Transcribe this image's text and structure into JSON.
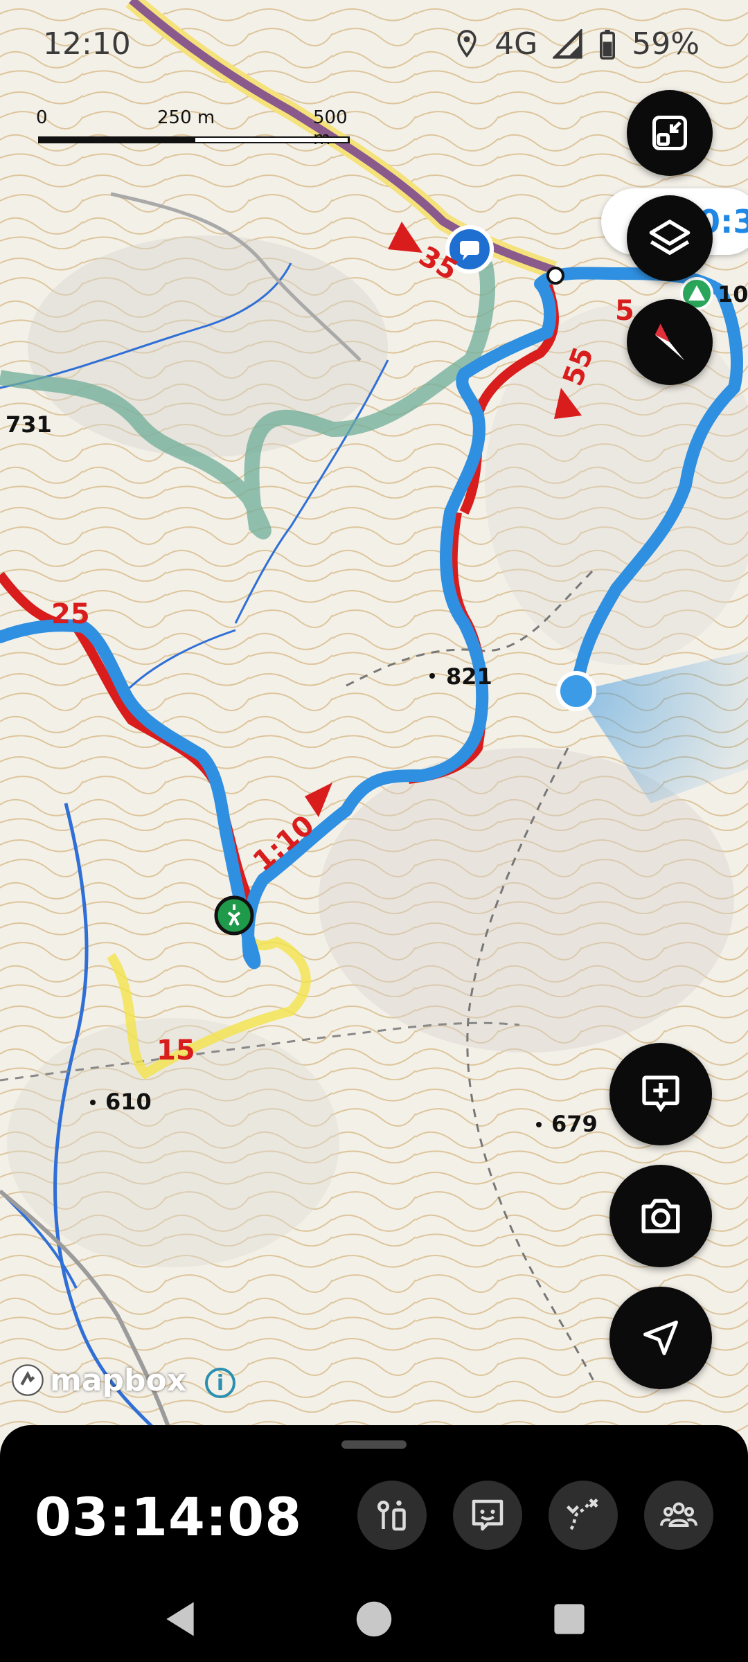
{
  "status_bar": {
    "time": "12:10",
    "network": "4G",
    "battery": "59%"
  },
  "scale_bar": {
    "start": "0",
    "mid": "250 m",
    "end": "500 m"
  },
  "map": {
    "route_number_labels": [
      "35",
      "55",
      "5",
      "25",
      "1:10",
      "15"
    ],
    "elevation_labels": [
      "731",
      "821",
      "610",
      "679",
      "10"
    ],
    "attribution": "mapbox"
  },
  "time_pill": {
    "text": "0:3"
  },
  "bottom_panel": {
    "elapsed_time": "03:14:08"
  },
  "colors": {
    "route_blue": "#2f8fe0",
    "route_red": "#d91c1c",
    "trail_yellow": "#f3e34a",
    "contour": "#c9a25a",
    "river": "#2f6fd6",
    "fab_bg": "#0b0b0b"
  },
  "icons": {
    "fullscreen": "fullscreen-exit-icon",
    "layers": "layers-icon",
    "compass": "compass-icon",
    "add_note": "add-comment-icon",
    "camera": "camera-icon",
    "navigate": "navigation-arrow-icon"
  }
}
